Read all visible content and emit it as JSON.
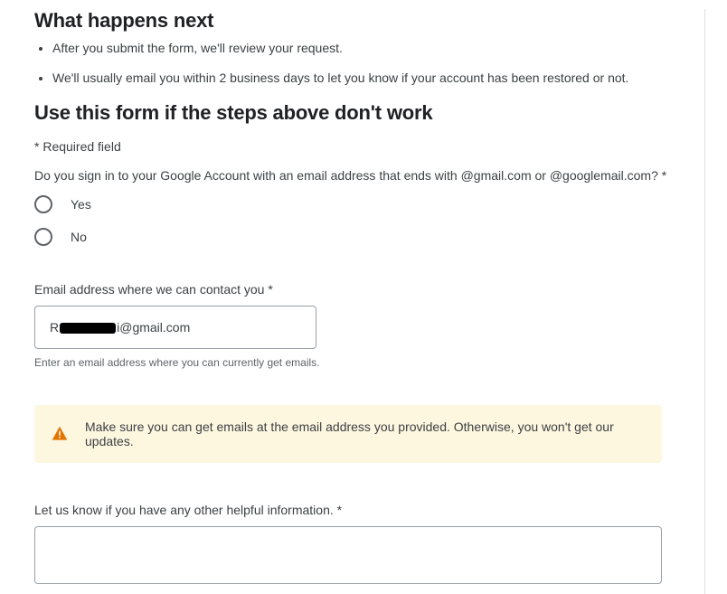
{
  "section1": {
    "heading": "What happens next",
    "bullets": [
      "After you submit the form, we'll review your request.",
      "We'll usually email you within 2 business days to let you know if your account has been restored or not."
    ]
  },
  "section2": {
    "heading": "Use this form if the steps above don't work",
    "required_note": "* Required field",
    "question": "Do you sign in to your Google Account with an email address that ends with @gmail.com or @googlemail.com? *",
    "options": [
      "Yes",
      "No"
    ]
  },
  "email_field": {
    "label": "Email address where we can contact you *",
    "value_prefix": "R",
    "value_redacted": true,
    "value_suffix": "i@gmail.com",
    "helper": "Enter an email address where you can currently get emails."
  },
  "banner": {
    "text": "Make sure you can get emails at the email address you provided. Otherwise, you won't get our updates."
  },
  "info_field": {
    "label": "Let us know if you have any other helpful information. *",
    "value": ""
  }
}
